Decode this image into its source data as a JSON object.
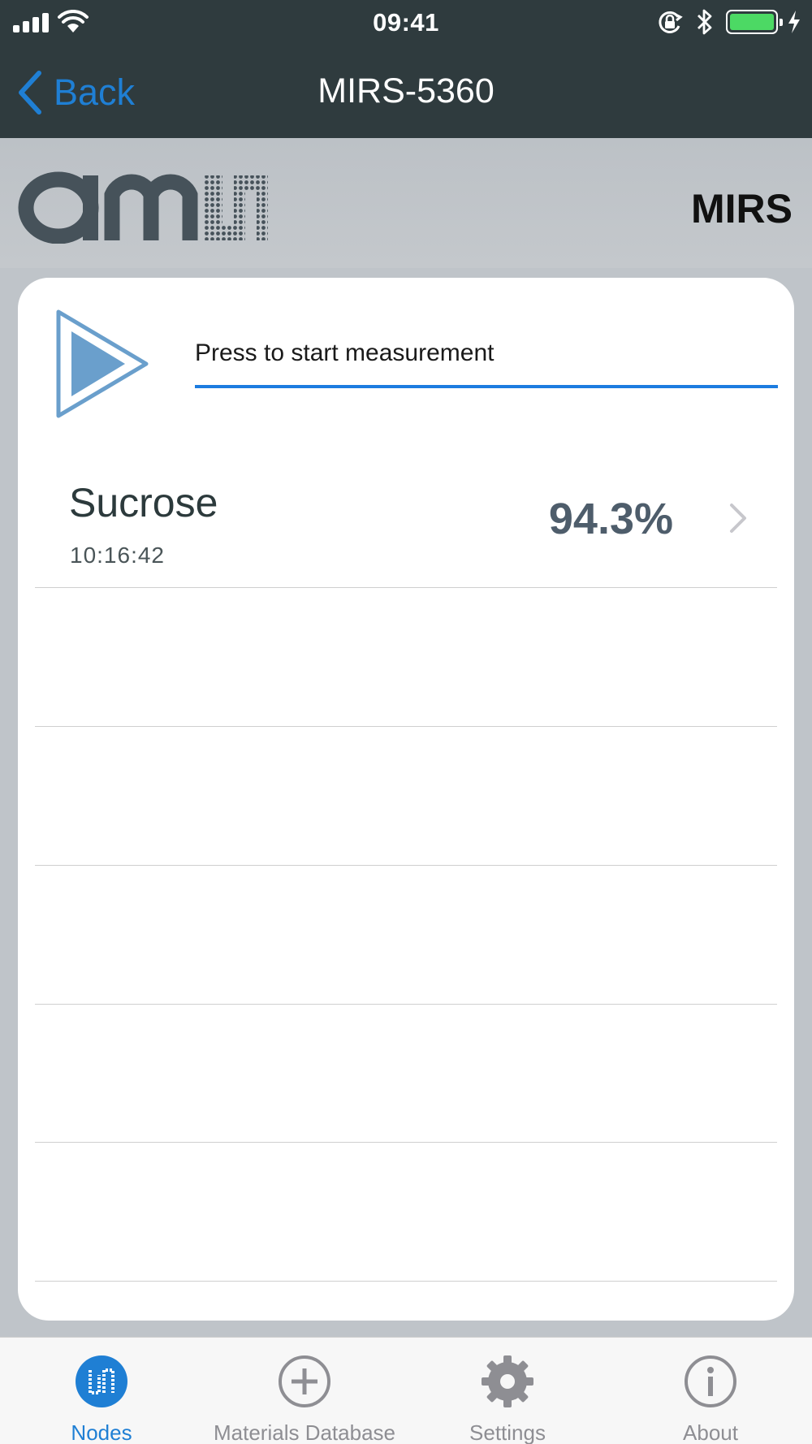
{
  "status_bar": {
    "time": "09:41"
  },
  "nav": {
    "back_label": "Back",
    "title": "MIRS-5360"
  },
  "brand": {
    "logo": "ams",
    "product": "MIRS"
  },
  "measurement": {
    "prompt": "Press to start measurement"
  },
  "results": [
    {
      "name": "Sucrose",
      "time": "10:16:42",
      "value": "94.3%"
    }
  ],
  "tabs": [
    {
      "label": "Nodes",
      "icon": "ams-nodes-icon",
      "active": true
    },
    {
      "label": "Materials Database",
      "icon": "plus-circle-icon",
      "active": false
    },
    {
      "label": "Settings",
      "icon": "gear-icon",
      "active": false
    },
    {
      "label": "About",
      "icon": "info-icon",
      "active": false
    }
  ],
  "colors": {
    "nav_background": "#2f3b3e",
    "accent": "#1f7fd4",
    "battery": "#4cd964",
    "value_text": "#4e5d6b"
  }
}
